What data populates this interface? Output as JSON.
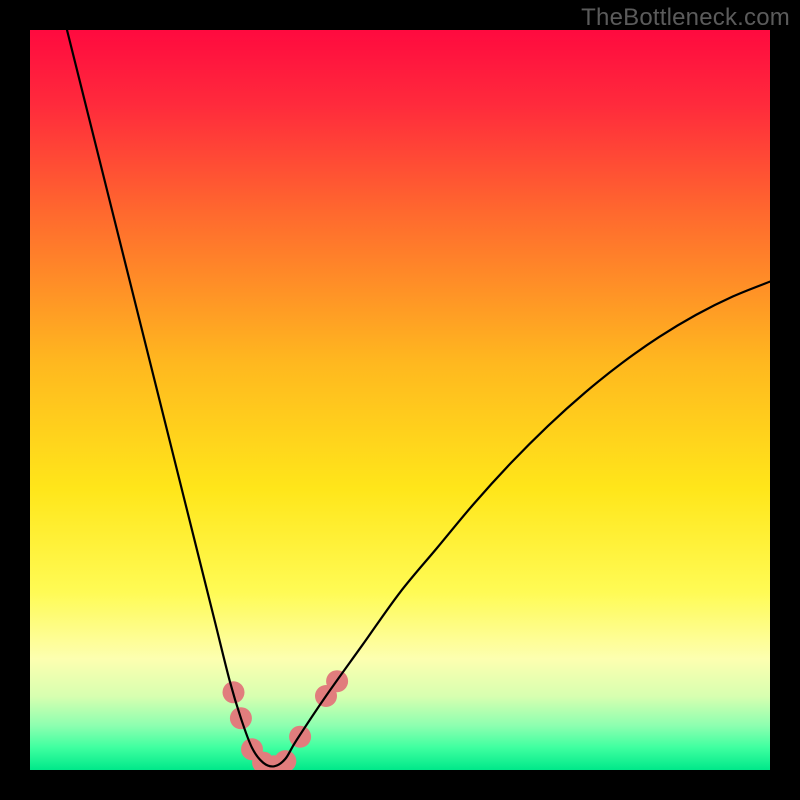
{
  "watermark": "TheBottleneck.com",
  "chart_data": {
    "type": "line",
    "title": "",
    "xlabel": "",
    "ylabel": "",
    "xlim": [
      0,
      100
    ],
    "ylim": [
      0,
      100
    ],
    "grid": false,
    "legend": false,
    "background_gradient": {
      "stops": [
        {
          "pos": 0.0,
          "color": "#ff0a3f"
        },
        {
          "pos": 0.1,
          "color": "#ff2a3c"
        },
        {
          "pos": 0.25,
          "color": "#ff6a2e"
        },
        {
          "pos": 0.45,
          "color": "#ffb81f"
        },
        {
          "pos": 0.62,
          "color": "#ffe61a"
        },
        {
          "pos": 0.76,
          "color": "#fffb55"
        },
        {
          "pos": 0.85,
          "color": "#fdffb0"
        },
        {
          "pos": 0.9,
          "color": "#d8ffb0"
        },
        {
          "pos": 0.94,
          "color": "#8dffb0"
        },
        {
          "pos": 0.97,
          "color": "#3effa0"
        },
        {
          "pos": 1.0,
          "color": "#00e88a"
        }
      ]
    },
    "series": [
      {
        "name": "bottleneck-curve",
        "stroke": "#000000",
        "stroke_width": 2.2,
        "x": [
          5,
          7,
          9,
          11,
          13,
          15,
          17,
          19,
          21,
          23,
          25,
          27,
          28.5,
          30,
          31.5,
          33,
          34.5,
          36,
          40,
          45,
          50,
          55,
          60,
          65,
          70,
          75,
          80,
          85,
          90,
          95,
          100
        ],
        "y": [
          100,
          92,
          84,
          76,
          68,
          60,
          52,
          44,
          36,
          28,
          20,
          12,
          7,
          3,
          1,
          0.5,
          1.5,
          4,
          10,
          17,
          24,
          30,
          36,
          41.5,
          46.5,
          51,
          55,
          58.5,
          61.5,
          64,
          66
        ]
      }
    ],
    "markers": {
      "name": "highlight-dots",
      "fill": "#e17d7d",
      "radius_px": 11,
      "points": [
        {
          "x": 27.5,
          "y": 10.5
        },
        {
          "x": 28.5,
          "y": 7.0
        },
        {
          "x": 30.0,
          "y": 2.8
        },
        {
          "x": 31.5,
          "y": 1.0
        },
        {
          "x": 33.0,
          "y": 0.5
        },
        {
          "x": 34.5,
          "y": 1.2
        },
        {
          "x": 36.5,
          "y": 4.5
        },
        {
          "x": 40.0,
          "y": 10.0
        },
        {
          "x": 41.5,
          "y": 12.0
        }
      ]
    }
  }
}
